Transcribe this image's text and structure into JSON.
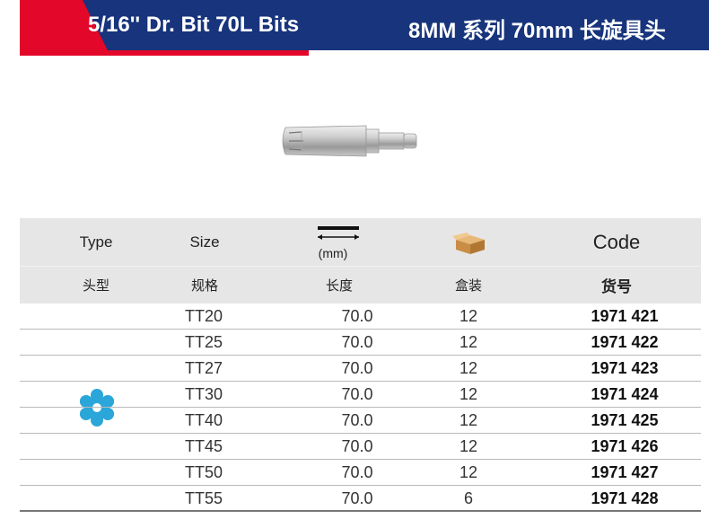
{
  "banner": {
    "title_left": "5/16'' Dr. Bit 70L Bits",
    "title_right": "8MM 系列 70mm 长旋具头",
    "colors": {
      "red": "#e3072a",
      "navy": "#17347c"
    }
  },
  "product_image": "torx-bit-photo",
  "table": {
    "headers_en": {
      "type": "Type",
      "size": "Size",
      "length_unit": "(mm)",
      "code": "Code"
    },
    "headers_cn": {
      "type": "头型",
      "size": "规格",
      "length": "长度",
      "box": "盒装",
      "code": "货号"
    },
    "type_icon": "torx-tamper-icon",
    "rows": [
      {
        "size": "TT20",
        "length": "70.0",
        "box": "12",
        "code": "1971 421"
      },
      {
        "size": "TT25",
        "length": "70.0",
        "box": "12",
        "code": "1971 422"
      },
      {
        "size": "TT27",
        "length": "70.0",
        "box": "12",
        "code": "1971 423"
      },
      {
        "size": "TT30",
        "length": "70.0",
        "box": "12",
        "code": "1971 424"
      },
      {
        "size": "TT40",
        "length": "70.0",
        "box": "12",
        "code": "1971 425"
      },
      {
        "size": "TT45",
        "length": "70.0",
        "box": "12",
        "code": "1971 426"
      },
      {
        "size": "TT50",
        "length": "70.0",
        "box": "12",
        "code": "1971 427"
      },
      {
        "size": "TT55",
        "length": "70.0",
        "box": "6",
        "code": "1971 428"
      }
    ]
  }
}
